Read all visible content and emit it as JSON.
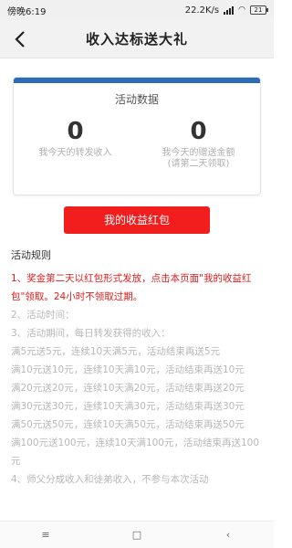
{
  "status_bar": {
    "time": "傍晚6:19",
    "speed": "22.2K/s",
    "battery": "21"
  },
  "header": {
    "title": "收入达标送大礼",
    "back_icon": "chevron-left-icon"
  },
  "stats_card": {
    "title": "活动数据",
    "accent_color": "#2b6cb8",
    "left": {
      "value": "0",
      "label": "我今天的转发收入"
    },
    "right": {
      "value": "0",
      "label_line1": "我今天的赠送金额",
      "label_line2": "(请第二天领取)"
    }
  },
  "red_button": {
    "label": "我的收益红包",
    "color": "#f21d1d"
  },
  "rules": {
    "title": "活动规则",
    "items": [
      "1、奖金第二天以红包形式发放，点击本页面\"我的收益红包\"领取。24小时不领取过期。",
      "2、活动时间：",
      "3、活动期间，每日转发获得的收入：",
      "满5元送5元，连续10天满5元，活动结束再送5元",
      "满10元送10元，连续10天满10元，活动结束再送10元",
      "满20元送20元，连续10天满20元，活动结束再送20元",
      "满30元送30元，连续10天满30元，活动结束再送30元",
      "满50元送50元，连续10天满50元，活动结束再送50元",
      "满100元送100元，连续10天满100元，活动结束再送100元",
      "4、师父分成收入和徒弟收入，不参与本次活动"
    ],
    "highlight_color": "#e11b1b"
  },
  "nav_bar": {
    "menu_icon": "≡",
    "home_icon": "□",
    "back_icon": "‹"
  }
}
